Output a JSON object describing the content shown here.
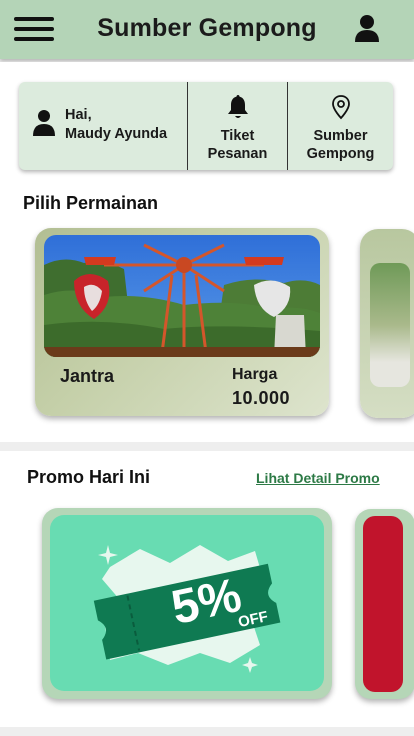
{
  "header": {
    "title": "Sumber Gempong"
  },
  "greeting": {
    "line1": "Hai,",
    "line2": "Maudy Ayunda"
  },
  "quick_actions": [
    {
      "line1": "Tiket",
      "line2": "Pesanan",
      "icon": "bell-icon"
    },
    {
      "line1": "Sumber",
      "line2": "Gempong",
      "icon": "location-pin-icon"
    }
  ],
  "games": {
    "title": "Pilih Permainan",
    "items": [
      {
        "name": "Jantra",
        "price_label": "Harga",
        "price": "10.000"
      }
    ]
  },
  "promo": {
    "title": "Promo Hari Ini",
    "link": "Lihat Detail Promo",
    "coupon_big": "5%",
    "coupon_small": "OFF"
  },
  "colors": {
    "header": "#b4d4b7",
    "accent_green": "#2d7a46",
    "promo_bg": "#68dcb2",
    "coupon": "#0f7a52",
    "peek_red": "#c1142c"
  }
}
